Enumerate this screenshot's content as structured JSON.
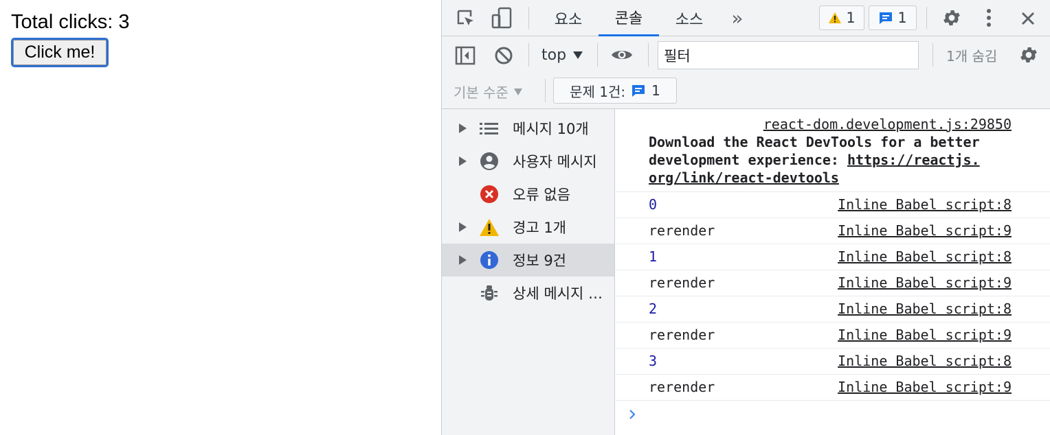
{
  "page": {
    "total_label": "Total clicks: 3",
    "button_label": "Click me!"
  },
  "devtools": {
    "tabs": [
      {
        "label": "요소"
      },
      {
        "label": "콘솔"
      },
      {
        "label": "소스"
      }
    ],
    "more_tabs": "»",
    "warnings_badge": "1",
    "messages_badge": "1",
    "toolbar": {
      "context": "top",
      "filter_value": "필터",
      "hidden_count": "1개 숨김",
      "levels": "기본 수준",
      "issues_label": "문제 1건:",
      "issues_count": "1"
    },
    "sidebar": [
      {
        "label": "메시지 10개",
        "icon": "list-icon"
      },
      {
        "label": "사용자 메시지",
        "icon": "user-icon"
      },
      {
        "label": "오류 없음",
        "icon": "error-icon"
      },
      {
        "label": "경고 1개",
        "icon": "warning-icon"
      },
      {
        "label": "정보 9건",
        "icon": "info-icon"
      },
      {
        "label": "상세 메시지 없음",
        "icon": "bug-icon"
      }
    ],
    "console": {
      "react_source": "react-dom.development.js:29850",
      "react_text": "Download the React DevTools for a better\ndevelopment experience: ",
      "react_link": "https://reactjs.\norg/link/react-devtools",
      "rows": [
        {
          "text": "0",
          "source": "Inline Babel script:8"
        },
        {
          "text": "rerender",
          "source": "Inline Babel script:9"
        },
        {
          "text": "1",
          "source": "Inline Babel script:8"
        },
        {
          "text": "rerender",
          "source": "Inline Babel script:9"
        },
        {
          "text": "2",
          "source": "Inline Babel script:8"
        },
        {
          "text": "rerender",
          "source": "Inline Babel script:9"
        },
        {
          "text": "3",
          "source": "Inline Babel script:8"
        },
        {
          "text": "rerender",
          "source": "Inline Babel script:9"
        }
      ]
    },
    "colors": {
      "accent": "#1a73e8",
      "warning": "#f2b600",
      "error": "#d93025",
      "info": "#3367d6",
      "number": "#1a1aa6"
    }
  }
}
